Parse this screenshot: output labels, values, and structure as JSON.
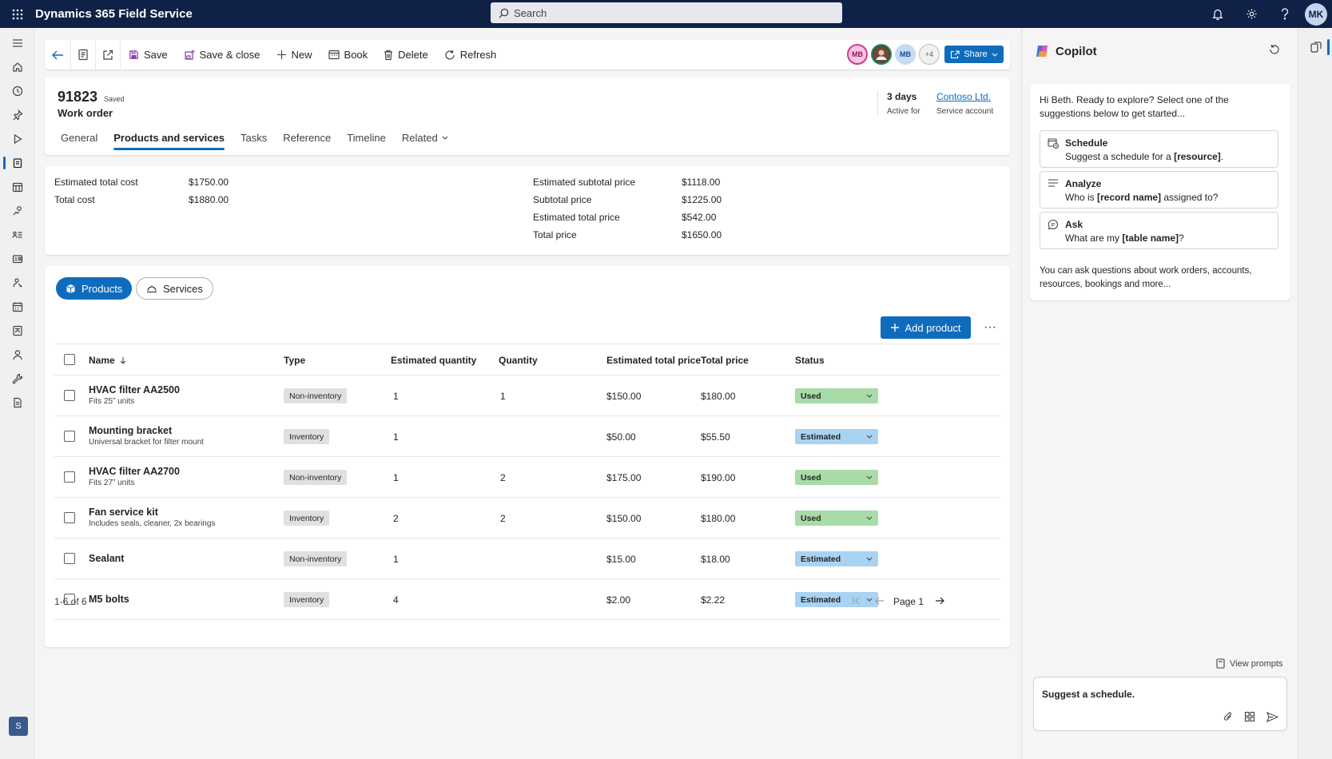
{
  "app": {
    "title": "Dynamics 365 Field Service",
    "user_initials": "MK"
  },
  "search": {
    "placeholder": "Search"
  },
  "commands": {
    "save": "Save",
    "save_close": "Save & close",
    "new": "New",
    "book": "Book",
    "delete": "Delete",
    "refresh": "Refresh",
    "share": "Share"
  },
  "presence": {
    "p1": "MB",
    "p3": "MB",
    "more": "+4"
  },
  "record": {
    "number": "91823",
    "saved": "Saved",
    "type": "Work order",
    "active_value": "3 days",
    "active_label": "Active for",
    "account_value": "Contoso Ltd.",
    "account_label": "Service account"
  },
  "tabs": [
    "General",
    "Products and services",
    "Tasks",
    "Reference",
    "Timeline",
    "Related"
  ],
  "totals": {
    "left": [
      {
        "label": "Estimated total cost",
        "value": "$1750.00"
      },
      {
        "label": "Total cost",
        "value": "$1880.00"
      }
    ],
    "right": [
      {
        "label": "Estimated subtotal price",
        "value": "$1118.00"
      },
      {
        "label": "Subtotal price",
        "value": "$1225.00"
      },
      {
        "label": "Estimated total price",
        "value": "$542.00"
      },
      {
        "label": "Total price",
        "value": "$1650.00"
      }
    ]
  },
  "toggle": {
    "products": "Products",
    "services": "Services"
  },
  "add_product": "Add product",
  "more_label": "···",
  "grid": {
    "headers": {
      "name": "Name",
      "type": "Type",
      "est_qty": "Estimated quantity",
      "qty": "Quantity",
      "est_total": "Estimated total price",
      "total": "Total price",
      "status": "Status"
    },
    "rows": [
      {
        "name": "HVAC filter AA2500",
        "desc": "Fits 25” units",
        "type": "Non-inventory",
        "est_qty": "1",
        "qty": "1",
        "est_total": "$150.00",
        "total": "$180.00",
        "status": "Used"
      },
      {
        "name": "Mounting bracket",
        "desc": "Universal bracket for filter mount",
        "type": "Inventory",
        "est_qty": "1",
        "qty": "",
        "est_total": "$50.00",
        "total": "$55.50",
        "status": "Estimated"
      },
      {
        "name": "HVAC filter AA2700",
        "desc": "Fits 27” units",
        "type": "Non-inventory",
        "est_qty": "1",
        "qty": "2",
        "est_total": "$175.00",
        "total": "$190.00",
        "status": "Used"
      },
      {
        "name": "Fan service kit",
        "desc": "Includes seals, cleaner, 2x bearings",
        "type": "Inventory",
        "est_qty": "2",
        "qty": "2",
        "est_total": "$150.00",
        "total": "$180.00",
        "status": "Used"
      },
      {
        "name": "Sealant",
        "desc": "",
        "type": "Non-inventory",
        "est_qty": "1",
        "qty": "",
        "est_total": "$15.00",
        "total": "$18.00",
        "status": "Estimated"
      },
      {
        "name": "M5 bolts",
        "desc": "",
        "type": "Inventory",
        "est_qty": "4",
        "qty": "",
        "est_total": "$2.00",
        "total": "$2.22",
        "status": "Estimated"
      }
    ],
    "count": "1-6 of 6",
    "page": "Page 1"
  },
  "status_colors": {
    "Used": "#a8dba8",
    "Estimated": "#a9d3f2"
  },
  "copilot": {
    "title": "Copilot",
    "greeting": "Hi Beth. Ready to explore? Select one of the suggestions below to get started...",
    "suggestions": [
      {
        "icon": "calendar-icon",
        "head": "Schedule",
        "pre": "Suggest a schedule for a ",
        "bold": "[resource]",
        "post": "."
      },
      {
        "icon": "lines-icon",
        "head": "Analyze",
        "pre": "Who is ",
        "bold": "[record name]",
        "post": " assigned to?"
      },
      {
        "icon": "chat-icon",
        "head": "Ask",
        "pre": "What are my ",
        "bold": "[table name]",
        "post": "?"
      }
    ],
    "footer": "You can ask questions about work orders, accounts, resources, bookings and more...",
    "view_prompts": "View prompts",
    "input_value": "Suggest a schedule."
  },
  "leftnav_badge": "S"
}
